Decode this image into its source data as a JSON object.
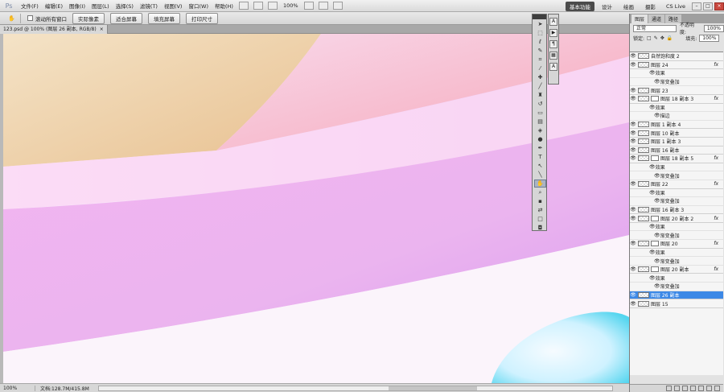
{
  "app": {
    "logo": "Ps",
    "menu": [
      "文件(F)",
      "编辑(E)",
      "图像(I)",
      "图层(L)",
      "选择(S)",
      "滤镜(T)",
      "视图(V)",
      "窗口(W)",
      "帮助(H)"
    ],
    "zoom": "100%",
    "workspaces": [
      "基本功能",
      "设计",
      "绘画",
      "摄影"
    ],
    "active_workspace": "基本功能",
    "cslive": "CS Live"
  },
  "options": {
    "scroll_all": "滚动所有窗口",
    "buttons": [
      "实际像素",
      "适合屏幕",
      "填充屏幕",
      "打印尺寸"
    ]
  },
  "document": {
    "tab": "123.psd @ 100% (图层 26 副本, RGB/8)",
    "status_zoom": "100%",
    "status_doc": "文档:128.7M/415.8M",
    "colors": {
      "peach": "#f1d4b3",
      "pink": "#f7c6f4",
      "lavender": "#ecb4ef",
      "white": "#fbf3fb",
      "cyan": "#45d7ee"
    }
  },
  "tools": [
    "move-icon",
    "marquee-icon",
    "lasso-icon",
    "quick-select-icon",
    "crop-icon",
    "eyedropper-icon",
    "healing-icon",
    "brush-icon",
    "stamp-icon",
    "history-brush-icon",
    "eraser-icon",
    "gradient-icon",
    "blur-icon",
    "dodge-icon",
    "pen-icon",
    "type-icon",
    "path-select-icon",
    "shape-icon",
    "hand-icon",
    "zoom-icon",
    "default-colors-icon",
    "swap-colors-icon",
    "foreground-color-icon",
    "background-color-icon",
    "quick-mask-icon"
  ],
  "mini_dock": [
    "A",
    "▶",
    "¶",
    "▦",
    "A"
  ],
  "layers": {
    "tabs": [
      "图层",
      "通道",
      "路径"
    ],
    "blend_mode": "正常",
    "opacity_label": "不透明度:",
    "opacity": "100%",
    "lock_label": "锁定:",
    "fill_label": "填充:",
    "fill": "100%",
    "rows": [
      {
        "type": "adjust",
        "name": "自然饱和度 2"
      },
      {
        "type": "layer",
        "name": "图层 24",
        "fx": true
      },
      {
        "type": "sub",
        "name": "效果"
      },
      {
        "type": "sub2",
        "name": "渐变叠加"
      },
      {
        "type": "layer",
        "name": "图层 23"
      },
      {
        "type": "layer",
        "name": "图层 18 副本 3",
        "fx": true,
        "mask": true
      },
      {
        "type": "sub",
        "name": "效果"
      },
      {
        "type": "sub2",
        "name": "描边"
      },
      {
        "type": "layer",
        "name": "图层 1 副本 4"
      },
      {
        "type": "layer",
        "name": "图层 10 副本"
      },
      {
        "type": "layer",
        "name": "图层 1 副本 3"
      },
      {
        "type": "layer",
        "name": "图层 16 副本"
      },
      {
        "type": "layer",
        "name": "图层 18 副本 5",
        "fx": true,
        "mask": true
      },
      {
        "type": "sub",
        "name": "效果"
      },
      {
        "type": "sub2",
        "name": "渐变叠加"
      },
      {
        "type": "layer",
        "name": "图层 22",
        "fx": true
      },
      {
        "type": "sub",
        "name": "效果"
      },
      {
        "type": "sub2",
        "name": "渐变叠加"
      },
      {
        "type": "layer",
        "name": "图层 16 副本 3"
      },
      {
        "type": "layer",
        "name": "图层 20 副本 2",
        "fx": true,
        "mask": true
      },
      {
        "type": "sub",
        "name": "效果"
      },
      {
        "type": "sub2",
        "name": "渐变叠加"
      },
      {
        "type": "layer",
        "name": "图层 20",
        "fx": true,
        "mask": true
      },
      {
        "type": "sub",
        "name": "效果"
      },
      {
        "type": "sub2",
        "name": "渐变叠加"
      },
      {
        "type": "layer",
        "name": "图层 20 副本",
        "fx": true,
        "mask": true
      },
      {
        "type": "sub",
        "name": "效果"
      },
      {
        "type": "sub2",
        "name": "渐变叠加"
      },
      {
        "type": "layer",
        "name": "图层 26 副本",
        "selected": true
      },
      {
        "type": "layer",
        "name": "图层 15"
      }
    ]
  }
}
